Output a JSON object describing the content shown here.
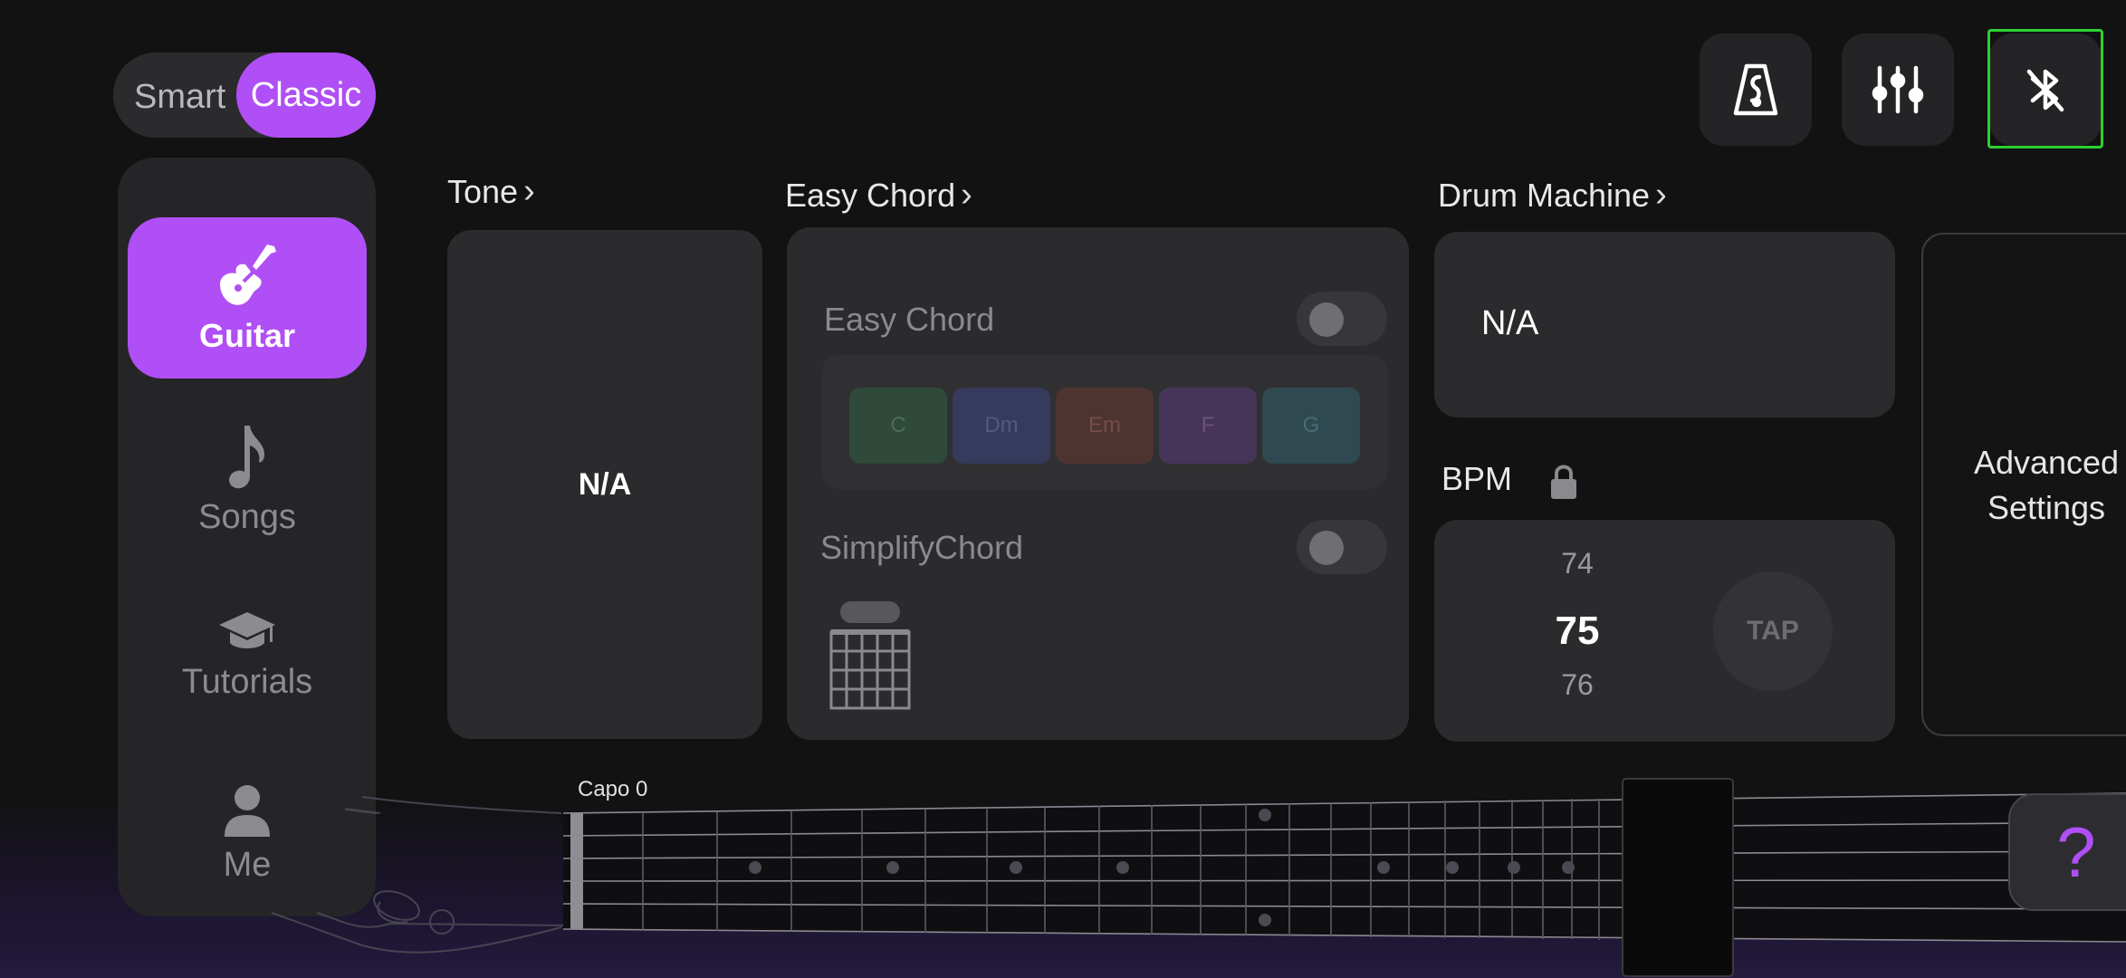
{
  "mode_switch": {
    "smart": "Smart",
    "classic": "Classic",
    "selected": "Classic"
  },
  "toolbar": {
    "metronome_icon": "metronome-icon",
    "mixer_icon": "sliders-icon",
    "bluetooth_icon": "bluetooth-off-icon"
  },
  "sidebar": {
    "items": [
      {
        "label": "Guitar",
        "icon": "electric-guitar-icon",
        "active": true
      },
      {
        "label": "Songs",
        "icon": "music-note-icon",
        "active": false
      },
      {
        "label": "Tutorials",
        "icon": "graduation-cap-icon",
        "active": false
      },
      {
        "label": "Me",
        "icon": "user-icon",
        "active": false
      }
    ]
  },
  "tone": {
    "title": "Tone",
    "value": "N/A"
  },
  "easy_chord": {
    "title": "Easy Chord",
    "toggle_label": "Easy Chord",
    "toggle_on": false,
    "chords": [
      {
        "name": "C",
        "color": "#2f4a3a",
        "text": "#4d6b57"
      },
      {
        "name": "Dm",
        "color": "#363a5c",
        "text": "#55597e"
      },
      {
        "name": "Em",
        "color": "#4e3431",
        "text": "#734d47"
      },
      {
        "name": "F",
        "color": "#473559",
        "text": "#6a5280"
      },
      {
        "name": "G",
        "color": "#2f4951",
        "text": "#4a6b74"
      }
    ],
    "simplify_label": "SimplifyChord",
    "simplify_on": false
  },
  "drum_machine": {
    "title": "Drum Machine",
    "value": "N/A"
  },
  "bpm": {
    "label": "BPM",
    "prev": "74",
    "current": "75",
    "next": "76",
    "tap": "TAP"
  },
  "advanced": {
    "line1": "Advanced",
    "line2": "Settings"
  },
  "fretboard": {
    "capo": "Capo 0"
  },
  "help": {
    "label": "?"
  },
  "colors": {
    "accent": "#b04ff5",
    "highlight": "#2bd032"
  }
}
